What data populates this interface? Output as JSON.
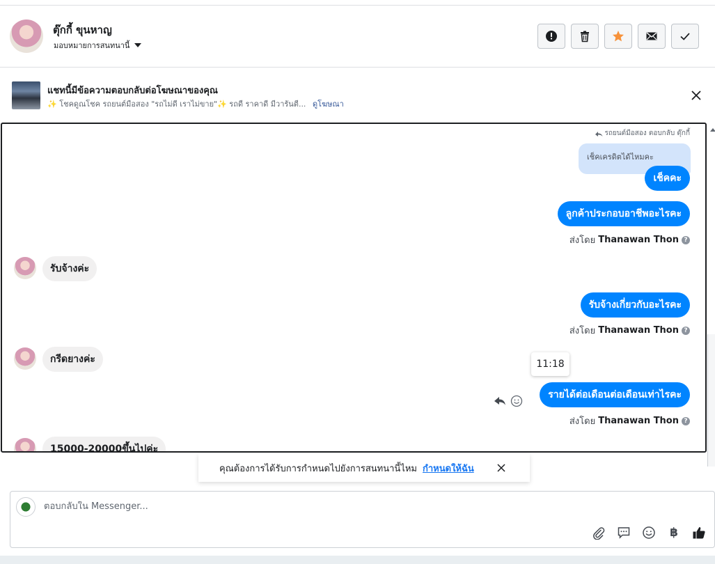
{
  "header": {
    "contact_name": "ตุ๊กกี้ ขุนหาญ",
    "assign_label": "มอบหมายการสนทนานี้",
    "actions": [
      "spam-icon",
      "trash-icon",
      "star-icon",
      "mail-icon",
      "check-icon"
    ],
    "star_color": "#f7923b"
  },
  "ad_banner": {
    "title": "แชทนี้มีข้อความตอบกลับต่อโฆษณาของคุณ",
    "subtitle": "✨ โชคดูณโชค รถยนต์มือสอง \"รถไม่ดี เราไม่ขาย\"✨ รถดี ราคาดี มีวารันตี...",
    "link": "ดูโฆษณา"
  },
  "conversation": {
    "reply_meta": "รถยนต์มือสอง ตอบกลับ ตุ๊กกี้",
    "quoted_text": "เช็คเครดิตได้ไหมคะ",
    "messages": [
      {
        "side": "out",
        "text": "เช็คคะ"
      },
      {
        "side": "out",
        "text": "ลูกค้าประกอบอาชีพอะไรคะ",
        "sent_by_label": "ส่งโดย",
        "sent_by_name": "Thanawan Thon"
      },
      {
        "side": "in",
        "text": "รับจ้างค่ะ"
      },
      {
        "side": "out",
        "text": "รับจ้างเกี่ยวกับอะไรคะ",
        "sent_by_label": "ส่งโดย",
        "sent_by_name": "Thanawan Thon"
      },
      {
        "side": "in",
        "text": "กรีดยางค่ะ"
      },
      {
        "side": "out",
        "text": "รายได้ต่อเดือนต่อเดือนเท่าไรคะ",
        "sent_by_label": "ส่งโดย",
        "sent_by_name": "Thanawan Thon"
      },
      {
        "side": "in",
        "text": "15000-20000ขึ้นไปค่ะ"
      }
    ],
    "tooltip_time": "11:18",
    "accent_color": "#0084ff"
  },
  "toast": {
    "text": "คุณต้องการได้รับการกำหนดไปยังการสนทนานี้ไหม",
    "link": "กำหนดให้ฉัน"
  },
  "composer": {
    "placeholder": "ตอบกลับใน Messenger...",
    "baht_symbol": "฿",
    "tools": [
      "attach-icon",
      "saved-reply-icon",
      "emoji-icon",
      "baht-icon",
      "like-icon"
    ]
  }
}
